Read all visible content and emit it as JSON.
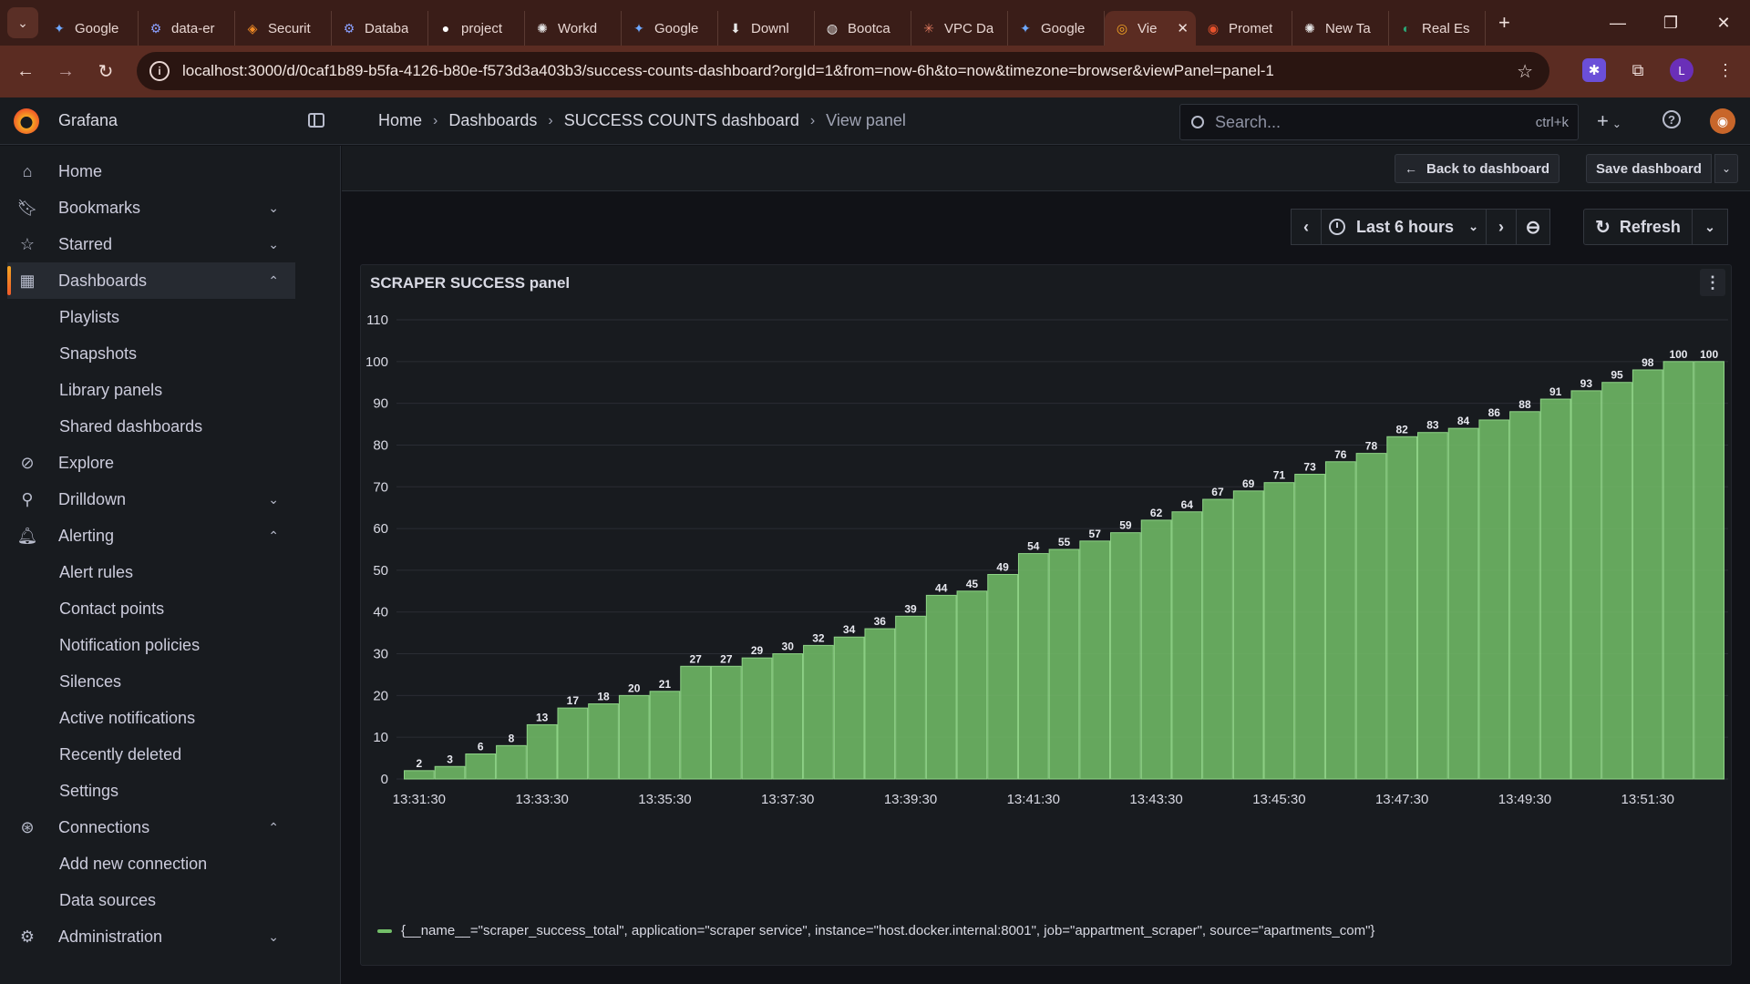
{
  "browser": {
    "tabs": [
      {
        "label": "Google",
        "icon": "gemini-icon"
      },
      {
        "label": "data-er",
        "icon": "drawio-icon"
      },
      {
        "label": "Securit",
        "icon": "security-icon"
      },
      {
        "label": "Databa",
        "icon": "drawio-icon"
      },
      {
        "label": "project",
        "icon": "github-icon"
      },
      {
        "label": "Workd",
        "icon": "chatgpt-icon"
      },
      {
        "label": "Google",
        "icon": "gemini-icon"
      },
      {
        "label": "Downl",
        "icon": "download-icon"
      },
      {
        "label": "Bootca",
        "icon": "globe-icon"
      },
      {
        "label": "VPC Da",
        "icon": "claude-icon"
      },
      {
        "label": "Google",
        "icon": "gemini-icon"
      },
      {
        "label": "Vie",
        "icon": "grafana-icon",
        "active": true
      },
      {
        "label": "Promet",
        "icon": "prometheus-icon"
      },
      {
        "label": "New Ta",
        "icon": "chatgpt-icon"
      },
      {
        "label": "Real Es",
        "icon": "realestate-icon"
      }
    ],
    "url": "localhost:3000/d/0caf1b89-b5fa-4126-b80e-f573d3a403b3/success-counts-dashboard?orgId=1&from=now-6h&to=now&timezone=browser&viewPanel=panel-1",
    "profile_initial": "L"
  },
  "grafana": {
    "brand": "Grafana",
    "breadcrumbs": [
      "Home",
      "Dashboards",
      "SUCCESS COUNTS dashboard",
      "View panel"
    ],
    "search_placeholder": "Search...",
    "search_shortcut": "ctrl+k",
    "nav": {
      "home": "Home",
      "bookmarks": "Bookmarks",
      "starred": "Starred",
      "dashboards": "Dashboards",
      "playlists": "Playlists",
      "snapshots": "Snapshots",
      "library_panels": "Library panels",
      "shared_dashboards": "Shared dashboards",
      "explore": "Explore",
      "drilldown": "Drilldown",
      "alerting": "Alerting",
      "alert_rules": "Alert rules",
      "contact_points": "Contact points",
      "notification_policies": "Notification policies",
      "silences": "Silences",
      "active_notifications": "Active notifications",
      "recently_deleted": "Recently deleted",
      "settings": "Settings",
      "connections": "Connections",
      "add_new_connection": "Add new connection",
      "data_sources": "Data sources",
      "administration": "Administration"
    },
    "toolbar": {
      "back_label": "Back to dashboard",
      "save_label": "Save dashboard",
      "time_range": "Last 6 hours",
      "refresh_label": "Refresh"
    },
    "panel": {
      "title": "SCRAPER SUCCESS panel",
      "legend": "{__name__=\"scraper_success_total\", application=\"scraper service\", instance=\"host.docker.internal:8001\", job=\"appartment_scraper\", source=\"apartments_com\"}"
    }
  },
  "chart_data": {
    "type": "bar",
    "values": [
      2,
      3,
      6,
      8,
      13,
      17,
      18,
      20,
      21,
      27,
      27,
      29,
      30,
      32,
      34,
      36,
      39,
      44,
      45,
      49,
      54,
      55,
      57,
      59,
      62,
      64,
      67,
      69,
      71,
      73,
      76,
      78,
      82,
      83,
      84,
      86,
      88,
      91,
      93,
      95,
      98,
      100,
      100
    ],
    "x_tick_labels": [
      "13:31:30",
      "13:33:30",
      "13:35:30",
      "13:37:30",
      "13:39:30",
      "13:41:30",
      "13:43:30",
      "13:45:30",
      "13:47:30",
      "13:49:30",
      "13:51:30"
    ],
    "y_ticks": [
      0,
      10,
      20,
      30,
      40,
      50,
      60,
      70,
      80,
      90,
      100,
      110
    ],
    "ylim": [
      0,
      110
    ],
    "bar_color": "#73bf69",
    "show_values": true,
    "grid": true,
    "legend_placement": "bottom"
  }
}
